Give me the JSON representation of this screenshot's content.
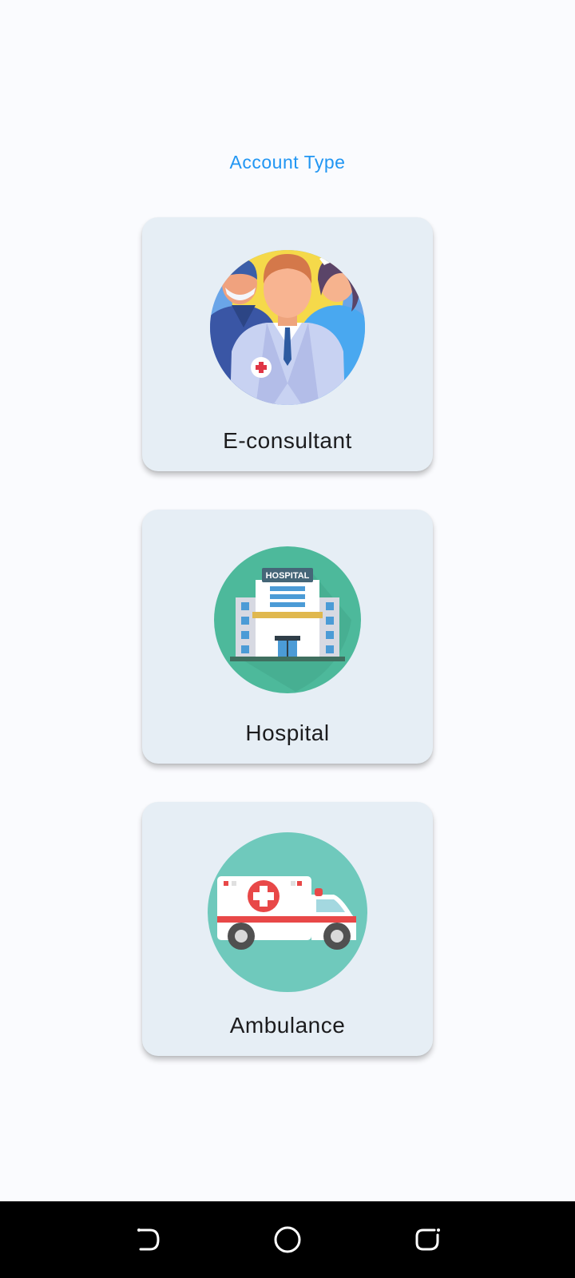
{
  "header": {
    "title": "Account Type"
  },
  "account_types": [
    {
      "label": "E-consultant",
      "icon": "doctors-group-icon"
    },
    {
      "label": "Hospital",
      "icon": "hospital-building-icon",
      "sign_text": "HOSPITAL"
    },
    {
      "label": "Ambulance",
      "icon": "ambulance-icon"
    }
  ],
  "navigation_bar": {
    "buttons": [
      "back-icon",
      "home-icon",
      "recents-icon"
    ]
  },
  "colors": {
    "accent": "#2196f3",
    "background": "#fafbfe",
    "card": "#e6eef5",
    "text": "#1c1c1e",
    "nav_bar": "#000000"
  }
}
